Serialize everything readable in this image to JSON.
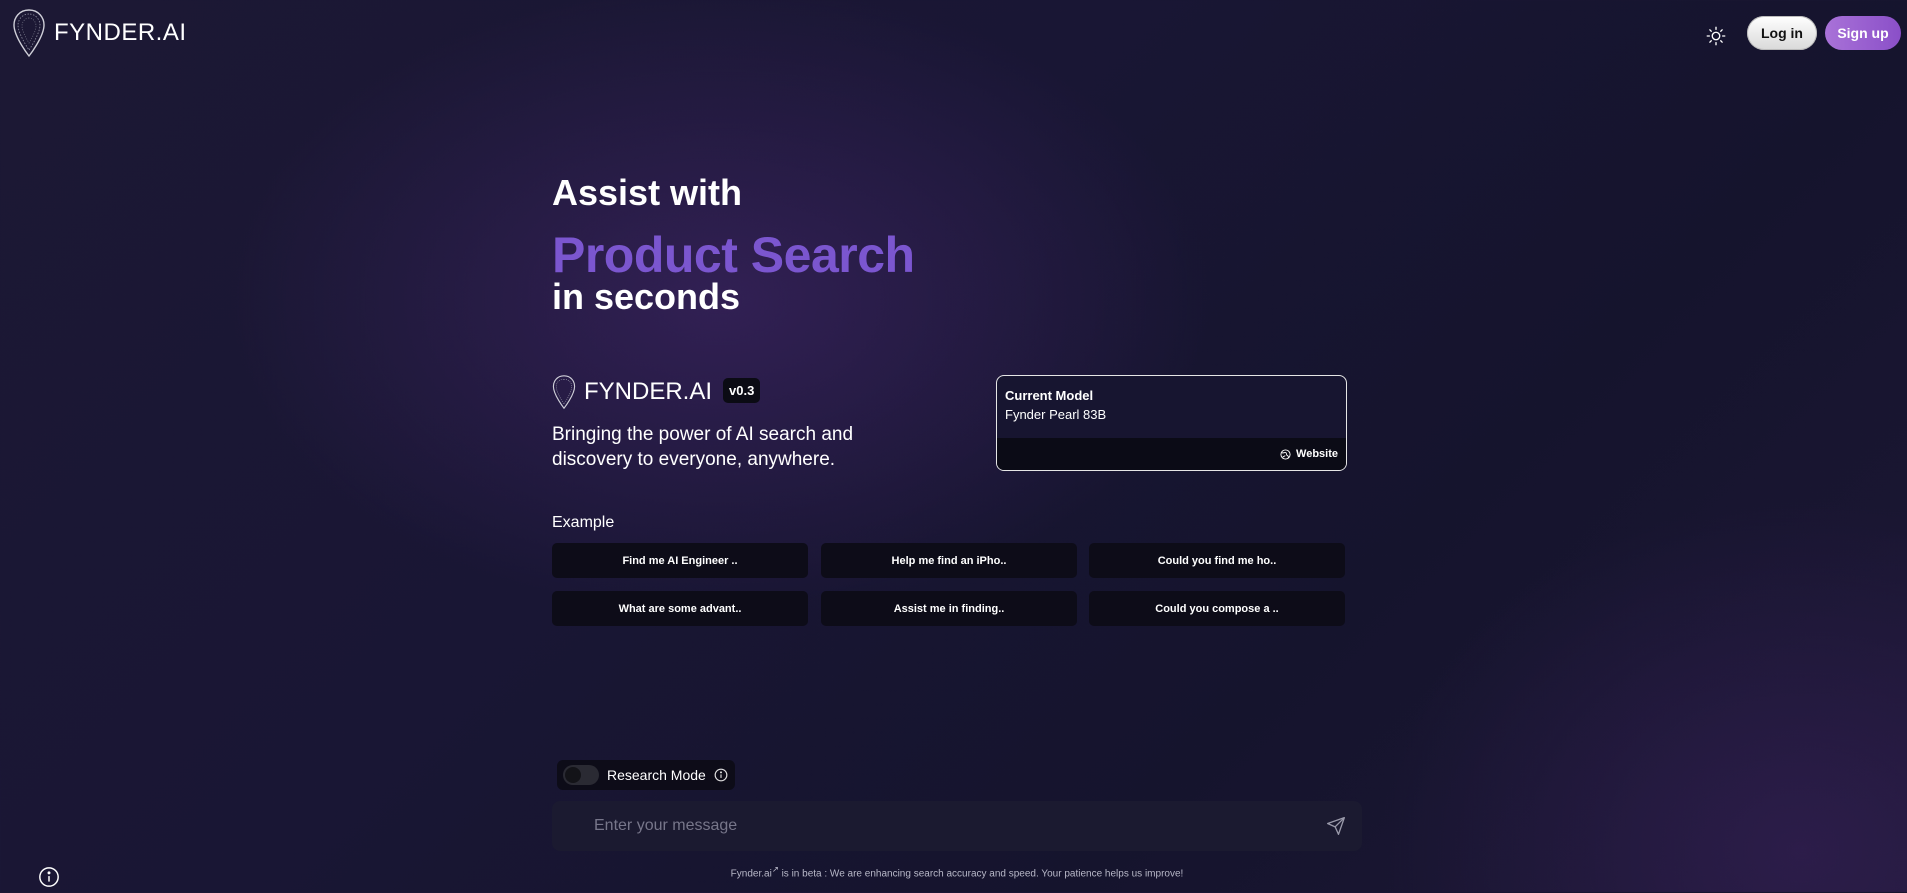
{
  "header": {
    "logo_text": "FYNDER.AI",
    "login_label": "Log in",
    "signup_label": "Sign up",
    "theme_icon": "sun-icon"
  },
  "hero": {
    "line1": "Assist with",
    "line2": "Product Search",
    "line3": "in seconds"
  },
  "brand": {
    "name": "FYNDER.AI",
    "version": "v0.3",
    "tagline": "Bringing the power of AI search and discovery to everyone, anywhere."
  },
  "model_card": {
    "label": "Current Model",
    "name": "Fynder Pearl 83B",
    "website_label": "Website"
  },
  "examples": {
    "label": "Example",
    "items": [
      "Find me AI Engineer ..",
      "Help me find an iPho..",
      "Could you find me ho..",
      "What are some advant..",
      "Assist me in finding..",
      "Could you compose a .."
    ]
  },
  "research_mode": {
    "label": "Research Mode",
    "enabled": false
  },
  "message_input": {
    "placeholder": "Enter your message",
    "value": ""
  },
  "footer": {
    "link": "Fynder.ai",
    "text": " is in beta : We are enhancing search accuracy and speed. Your patience helps us improve!"
  },
  "colors": {
    "accent": "#7b56cf",
    "signup_gradient_start": "#a972d8",
    "signup_gradient_end": "#8a4fc8"
  }
}
